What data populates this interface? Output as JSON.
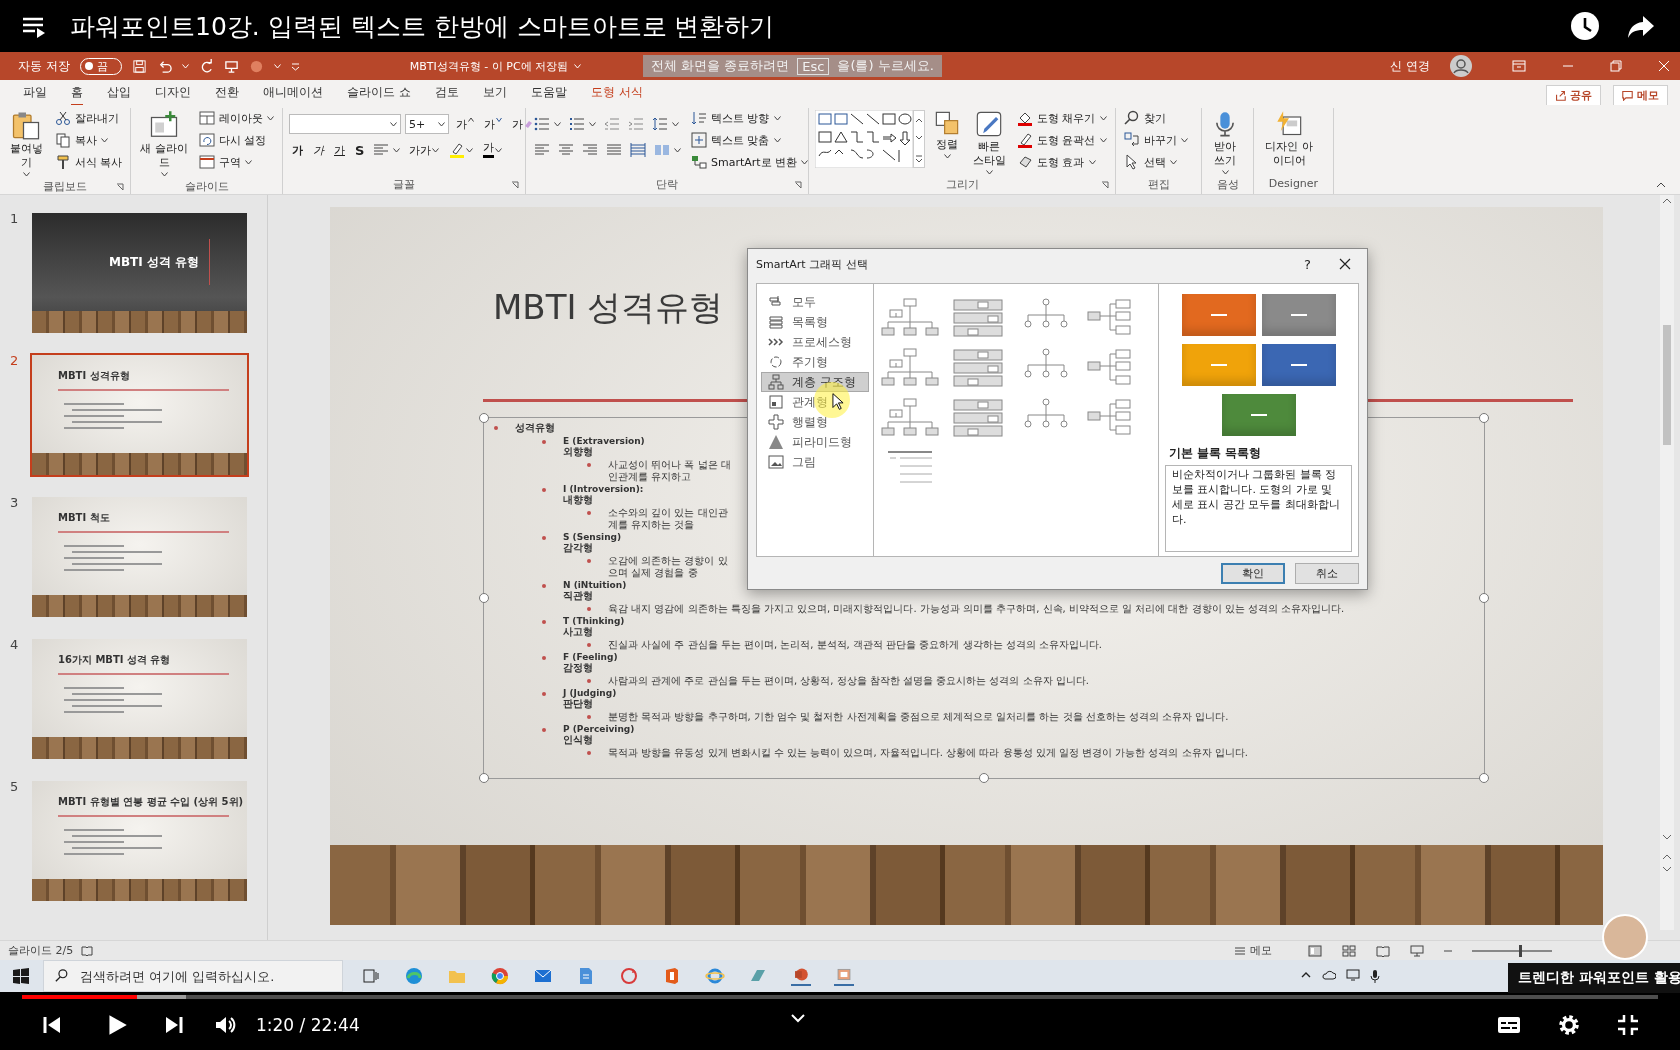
{
  "video": {
    "title": "파워포인트10강. 입력된 텍스트 한방에 스마트아트로 변환하기",
    "time": "1:20 / 22:44",
    "progress": {
      "level": 0.07
    },
    "branding": "트렌디한 파워포인트 활용"
  },
  "fullscreen_hint": {
    "before": "전체 화면을 종료하려면",
    "key": "Esc",
    "after": "을(를) 누르세요."
  },
  "titlebar": {
    "autosave_label": "자동 저장",
    "autosave": {
      "on": false,
      "state": "끔"
    },
    "document": "MBTI성격유형 - 이 PC에 저장됨",
    "user": "신 연경"
  },
  "menu_tabs": [
    {
      "label": "파일",
      "selected": false,
      "contextual": false
    },
    {
      "label": "홈",
      "selected": true,
      "contextual": false
    },
    {
      "label": "삽입",
      "selected": false,
      "contextual": false
    },
    {
      "label": "디자인",
      "selected": false,
      "contextual": false
    },
    {
      "label": "전환",
      "selected": false,
      "contextual": false
    },
    {
      "label": "애니메이션",
      "selected": false,
      "contextual": false
    },
    {
      "label": "슬라이드 쇼",
      "selected": false,
      "contextual": false
    },
    {
      "label": "검토",
      "selected": false,
      "contextual": false
    },
    {
      "label": "보기",
      "selected": false,
      "contextual": false
    },
    {
      "label": "도움말",
      "selected": false,
      "contextual": false
    },
    {
      "label": "도형 서식",
      "selected": false,
      "contextual": true
    }
  ],
  "share": "공유",
  "comments": "메모",
  "ribbon": {
    "clipboard": {
      "paste": "붙여넣기",
      "cut": "잘라내기",
      "copy": "복사",
      "format_painter": "서식 복사",
      "label": "클립보드"
    },
    "slides": {
      "new_slide": "새 슬라이드",
      "layout": "레이아웃",
      "reset": "다시 설정",
      "section": "구역",
      "label": "슬라이드"
    },
    "font": {
      "size": "5+",
      "grow": "가",
      "shrink": "가",
      "clear": "가",
      "format_buttons": [
        {
          "kind": "bold",
          "label": "가"
        },
        {
          "kind": "italic",
          "label": "가"
        },
        {
          "kind": "underline",
          "label": "가"
        },
        {
          "kind": "strike",
          "label": "S"
        }
      ],
      "case": "가가",
      "font_color": "가",
      "label": "글꼴"
    },
    "paragraph": {
      "text_direction": "텍스트 방향",
      "align_text": "텍스트 맞춤",
      "smartart": "SmartArt로 변환",
      "label": "단락"
    },
    "drawing": {
      "arrange": "정렬",
      "quick_styles": "빠른 스타일",
      "fill": "도형 채우기",
      "outline": "도형 윤곽선",
      "effects": "도형 효과",
      "label": "그리기"
    },
    "editing": {
      "find": "찾기",
      "replace": "바꾸기",
      "select": "선택",
      "label": "편집"
    },
    "voice": {
      "dictate": "받아 쓰기",
      "label": "음성"
    },
    "designer": {
      "ideas": "디자인 아이디어",
      "label": "Designer"
    }
  },
  "thumbnails": [
    {
      "number": "1",
      "kind": "title",
      "title": "MBTI 성격 유형",
      "selected": false
    },
    {
      "number": "2",
      "kind": "content",
      "title": "MBTI 성격유형",
      "selected": true
    },
    {
      "number": "3",
      "kind": "content",
      "title": "MBTI 척도",
      "selected": false
    },
    {
      "number": "4",
      "kind": "content",
      "title": "16가지 MBTI 성격 유형",
      "selected": false
    },
    {
      "number": "5",
      "kind": "content",
      "title": "MBTI 유형별 연봉 평균 수입 (상위 5위)",
      "selected": false
    }
  ],
  "slide": {
    "title": "MBTI 성격유형",
    "heading": "성격유형",
    "items": [
      {
        "code": "E (Extraversion)",
        "name": "외향형",
        "description": "사교성이 뛰어나 폭 넓은 대인관계를 유지하고"
      },
      {
        "code": "I (Introversion):",
        "name": "내향형",
        "description": "소수와의 깊이 있는 대인관계를 유지하는 것을"
      },
      {
        "code": "S (Sensing)",
        "name": "감각형",
        "description": "오감에 의존하는 경향이 있으며 실제 경험을 중"
      },
      {
        "code": "N (iNtuition)",
        "name": "직관형",
        "description": "육감 내지 영감에 의존하는 특징을 가지고 있으며, 미래지향적입니다. 가능성과 의미를 추구하며, 신속, 비약적으로 일 처리에 대한 경향이 있는 성격의 소유자입니다."
      },
      {
        "code": "T (Thinking)",
        "name": "사고형",
        "description": "진실과 사실에 주 관심을 두는 편이며, 논리적, 분석적, 객관적 판단을 중요하게 생각하는 성격의 소유자입니다."
      },
      {
        "code": "F (Feeling)",
        "name": "감정형",
        "description": "사람과의 관계에 주로 관심을 두는 편이며, 상황적, 정상을 참작한 설명을 중요시하는 성격의 소유자 입니다."
      },
      {
        "code": "J (Judging)",
        "name": "판단형",
        "description": "분명한 목적과 방향을 추구하며, 기한 엄수 및 철저한 사전계획을 중점으로 체계적으로 일처리를 하는 것을 선호하는 성격의 소유자 입니다."
      },
      {
        "code": "P (Perceiving)",
        "name": "인식형",
        "description": "목적과 방향을 유동성 있게 변화시킬 수 있는 능력이 있으며, 자율적입니다. 상황에 따라 융통성 있게 일정 변경이 가능한 성격의 소유자 입니다."
      }
    ]
  },
  "dialog": {
    "title": "SmartArt 그래픽 선택",
    "help": "?",
    "categories": [
      {
        "label": "모두",
        "selected": false
      },
      {
        "label": "목록형",
        "selected": false
      },
      {
        "label": "프로세스형",
        "selected": false
      },
      {
        "label": "주기형",
        "selected": false
      },
      {
        "label": "계층 구조형",
        "selected": true
      },
      {
        "label": "관계형",
        "selected": false
      },
      {
        "label": "행렬형",
        "selected": false
      },
      {
        "label": "피라미드형",
        "selected": false
      },
      {
        "label": "그림",
        "selected": false
      }
    ],
    "preview": {
      "blocks": [
        {
          "color": "#e2691f"
        },
        {
          "color": "#8a8a8a"
        },
        {
          "color": "#f0a30a"
        },
        {
          "color": "#3b67b3"
        },
        {
          "color": "#4e8a3c"
        }
      ],
      "name": "기본 블록 목록형",
      "description": "비순차적이거나 그룹화된 블록 정보를 표시합니다. 도형의 가로 및 세로 표시 공간 모두를 최대화합니다."
    },
    "buttons": [
      {
        "label": "확인",
        "default": true
      },
      {
        "label": "취소",
        "default": false
      }
    ]
  },
  "status_bar": {
    "slide": "슬라이드 2/5",
    "notes": "메모",
    "zoom": {
      "level": 0.6
    }
  },
  "taskbar": {
    "search_placeholder": "검색하려면 여기에 입력하십시오."
  }
}
